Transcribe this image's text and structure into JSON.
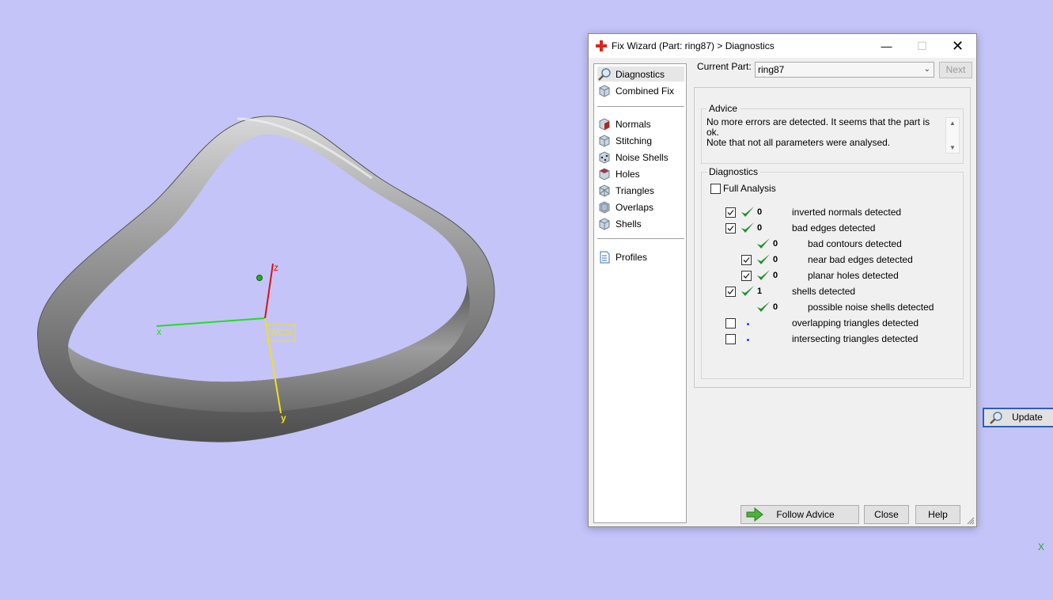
{
  "viewport": {
    "background": "#c4c4f8",
    "axes": {
      "x_label": "x",
      "y_label": "y",
      "z_label": "z",
      "wcs_label": "WCS",
      "corner_axis_label": "X"
    }
  },
  "window": {
    "title": "Fix Wizard (Part: ring87) > Diagnostics",
    "minimize": "—",
    "maximize": "☐",
    "close": "✕"
  },
  "nav": {
    "top_items": [
      {
        "label": "Diagnostics",
        "icon": "magnifier-icon",
        "selected": true
      },
      {
        "label": "Combined Fix",
        "icon": "combined-fix-icon"
      }
    ],
    "fix_items": [
      {
        "label": "Normals",
        "icon": "normals-cube-icon"
      },
      {
        "label": "Stitching",
        "icon": "stitching-cube-icon"
      },
      {
        "label": "Noise Shells",
        "icon": "noise-shells-cube-icon"
      },
      {
        "label": "Holes",
        "icon": "holes-cube-icon"
      },
      {
        "label": "Triangles",
        "icon": "triangles-cube-icon"
      },
      {
        "label": "Overlaps",
        "icon": "overlaps-cube-icon"
      },
      {
        "label": "Shells",
        "icon": "shells-cube-icon"
      }
    ],
    "bottom_items": [
      {
        "label": "Profiles",
        "icon": "profiles-document-icon"
      }
    ]
  },
  "header": {
    "current_part_label": "Current Part:",
    "current_part_value": "ring87",
    "next_label": "Next"
  },
  "advice": {
    "title": "Advice",
    "line1": "No more errors are detected. It seems that the part is ok.",
    "line2": "Note that not all parameters were analysed."
  },
  "diagnostics": {
    "title": "Diagnostics",
    "full_analysis_label": "Full Analysis",
    "full_analysis_checked": false,
    "rows": [
      {
        "checkbox": true,
        "checked": true,
        "status": "ok",
        "count": "0",
        "text": "inverted normals detected",
        "indent": 0
      },
      {
        "checkbox": true,
        "checked": true,
        "status": "ok",
        "count": "0",
        "text": "bad edges detected",
        "indent": 0
      },
      {
        "checkbox": false,
        "checked": false,
        "status": "ok",
        "count": "0",
        "text": "bad contours detected",
        "indent": 1
      },
      {
        "checkbox": true,
        "checked": true,
        "status": "ok",
        "count": "0",
        "text": "near bad edges detected",
        "indent": 1
      },
      {
        "checkbox": true,
        "checked": true,
        "status": "ok",
        "count": "0",
        "text": "planar holes detected",
        "indent": 1
      },
      {
        "checkbox": true,
        "checked": true,
        "status": "ok",
        "count": "1",
        "text": "shells detected",
        "indent": 0
      },
      {
        "checkbox": false,
        "checked": false,
        "status": "ok",
        "count": "0",
        "text": "possible noise shells detected",
        "indent": 1
      },
      {
        "checkbox": true,
        "checked": false,
        "status": "none",
        "count": "",
        "text": "overlapping triangles detected",
        "indent": 0
      },
      {
        "checkbox": true,
        "checked": false,
        "status": "none",
        "count": "",
        "text": "intersecting triangles detected",
        "indent": 0
      }
    ],
    "update_label": "Update"
  },
  "footer": {
    "follow_advice_label": "Follow Advice",
    "close_label": "Close",
    "help_label": "Help"
  },
  "colors": {
    "check_green": "#1f8f2a",
    "update_border": "#2d5fb8",
    "axis_x": "#22dd22",
    "axis_y": "#f0e020",
    "axis_z": "#dd1111"
  }
}
